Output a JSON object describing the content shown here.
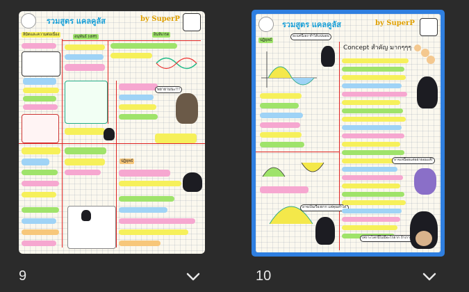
{
  "pages": [
    {
      "number": "9",
      "title": "รวมสูตร แคลคูลัส",
      "byline": "by SuperP",
      "sections": [
        "ลิมิตและความต่อเนื่อง",
        "อนุพันธ์ (diff)",
        "อินทิเกรต",
        "ปฏิยุทธ์"
      ],
      "bubble": "พยายามนะ!!!",
      "selected": false
    },
    {
      "number": "10",
      "title": "รวมสูตร แคลคูลัส",
      "byline": "by SuperP",
      "sections": [
        "ปฏิยุทธ์",
        "Concept สำคัญ มากๆๆๆ"
      ],
      "bubble_top": "อะแค่นี้เอง ทำได้แน่นอน",
      "bubble_mid": "อาจเป็นเรื่องยาก แต่คุณทำได้",
      "bubble_bottom": "อาจเหนื่อยแต่อย่ายอมแพ้!",
      "bubble_last": "เพราะโลกนี้ไม่มีอะไรยาก ถ้าเราตั้งใจทำ",
      "selected": true
    }
  ],
  "icons": {
    "page9_menu": "chevron-down-icon",
    "page10_menu": "chevron-down-icon"
  },
  "colors": {
    "selection": "#2f7fe0",
    "background": "#2b2b2b"
  }
}
